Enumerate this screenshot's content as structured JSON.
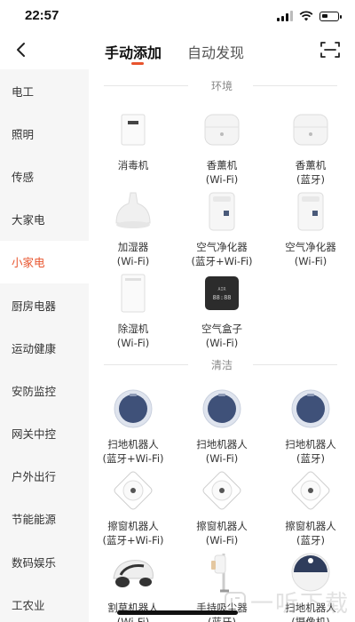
{
  "status": {
    "time": "22:57"
  },
  "header": {
    "tab_manual": "手动添加",
    "tab_auto": "自动发现",
    "accent": "#e8542d"
  },
  "sidebar": {
    "active_index": 4,
    "items": [
      {
        "label": "电工"
      },
      {
        "label": "照明"
      },
      {
        "label": "传感"
      },
      {
        "label": "大家电"
      },
      {
        "label": "小家电"
      },
      {
        "label": "厨房电器"
      },
      {
        "label": "运动健康"
      },
      {
        "label": "安防监控"
      },
      {
        "label": "网关中控"
      },
      {
        "label": "户外出行"
      },
      {
        "label": "节能能源"
      },
      {
        "label": "数码娱乐"
      },
      {
        "label": "工农业"
      }
    ]
  },
  "sections": [
    {
      "title": "环境",
      "devices": [
        {
          "name": "消毒机",
          "sub": "",
          "icon": "sterilizer-icon"
        },
        {
          "name": "香薰机",
          "sub": "(Wi-Fi)",
          "icon": "aroma-diffuser-icon"
        },
        {
          "name": "香薰机",
          "sub": "(蓝牙)",
          "icon": "aroma-diffuser-icon"
        },
        {
          "name": "加湿器",
          "sub": "(Wi-Fi)",
          "icon": "humidifier-icon"
        },
        {
          "name": "空气净化器",
          "sub": "(蓝牙+Wi-Fi)",
          "icon": "air-purifier-icon"
        },
        {
          "name": "空气净化器",
          "sub": "(Wi-Fi)",
          "icon": "air-purifier-icon"
        },
        {
          "name": "除湿机",
          "sub": "(Wi-Fi)",
          "icon": "dehumidifier-icon"
        },
        {
          "name": "空气盒子",
          "sub": "(Wi-Fi)",
          "icon": "air-box-icon"
        }
      ]
    },
    {
      "title": "清洁",
      "devices": [
        {
          "name": "扫地机器人",
          "sub": "(蓝牙+Wi-Fi)",
          "icon": "robot-vacuum-icon"
        },
        {
          "name": "扫地机器人",
          "sub": "(Wi-Fi)",
          "icon": "robot-vacuum-icon"
        },
        {
          "name": "扫地机器人",
          "sub": "(蓝牙)",
          "icon": "robot-vacuum-icon"
        },
        {
          "name": "擦窗机器人",
          "sub": "(蓝牙+Wi-Fi)",
          "icon": "window-robot-icon"
        },
        {
          "name": "擦窗机器人",
          "sub": "(Wi-Fi)",
          "icon": "window-robot-icon"
        },
        {
          "name": "擦窗机器人",
          "sub": "(蓝牙)",
          "icon": "window-robot-icon"
        },
        {
          "name": "割草机器人",
          "sub": "(Wi-Fi)",
          "icon": "lawn-mower-robot-icon"
        },
        {
          "name": "手持吸尘器",
          "sub": "(蓝牙)",
          "icon": "handheld-vacuum-icon"
        },
        {
          "name": "扫地机器人",
          "sub": "(摄像机)",
          "icon": "camera-robot-vacuum-icon"
        }
      ]
    }
  ],
  "watermark": {
    "text": "一听下载"
  }
}
